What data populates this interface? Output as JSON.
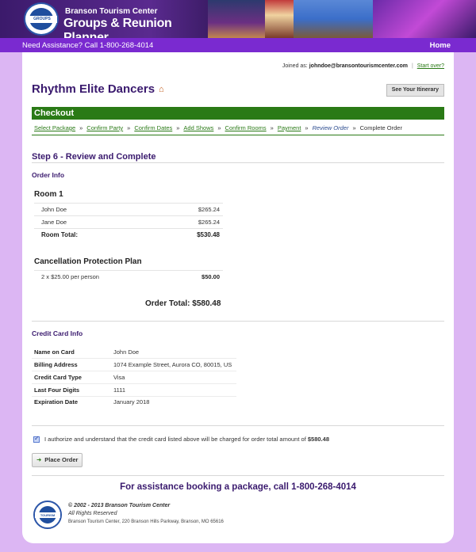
{
  "banner": {
    "brand_top": "Branson Tourism Center",
    "brand_main": "Groups & Reunion Planner",
    "seal_text": "GROUPS"
  },
  "navbar": {
    "assist": "Need Assistance? Call 1-800-268-4014",
    "home": "Home"
  },
  "joined": {
    "label": "Joined as:",
    "email": "johndoe@bransontourismcenter.com",
    "start_over": "Start over?"
  },
  "header": {
    "title": "Rhythm Elite Dancers",
    "itinerary_button": "See Your Itinerary"
  },
  "checkout": {
    "bar_title": "Checkout",
    "steps": [
      "Select Package",
      "Confirm Party",
      "Confirm Dates",
      "Add Shows",
      "Confirm Rooms",
      "Payment",
      "Review Order",
      "Complete Order"
    ],
    "separator": "»"
  },
  "step_heading": "Step 6 - Review and Complete",
  "order_info": {
    "heading": "Order Info",
    "room": {
      "title": "Room 1",
      "guests": [
        {
          "name": "John Doe",
          "price": "$265.24"
        },
        {
          "name": "Jane Doe",
          "price": "$265.24"
        }
      ],
      "total_label": "Room Total:",
      "total_value": "$530.48"
    },
    "cancellation": {
      "title": "Cancellation Protection Plan",
      "line": "2 x $25.00 per person",
      "value": "$50.00"
    },
    "order_total": "Order Total: $580.48"
  },
  "credit_card": {
    "heading": "Credit Card Info",
    "rows": [
      {
        "label": "Name on Card",
        "value": "John Doe"
      },
      {
        "label": "Billing Address",
        "value": "1074 Example Street, Aurora CO, 80015, US"
      },
      {
        "label": "Credit Card Type",
        "value": "Visa"
      },
      {
        "label": "Last Four Digits",
        "value": "1111"
      },
      {
        "label": "Expiration Date",
        "value": "January 2018"
      }
    ]
  },
  "authorize": {
    "text": "I authorize and understand that the credit card listed above will be charged for order total amount of",
    "amount": "$580.48",
    "checked": true
  },
  "place_order_label": "Place Order",
  "assist_big": "For assistance booking a package, call 1-800-268-4014",
  "footer": {
    "copyright": "© 2002 - 2013 Branson Tourism Center",
    "rights": "All Rights Reserved",
    "address": "Branson Tourism Center, 220 Branson Hills Parkway, Branson, MO 65616",
    "seal_text": "TOURISM"
  },
  "colors": {
    "accent_purple": "#3a1a6e",
    "nav_purple": "#7a2ad0",
    "checkout_green": "#2a7a16",
    "page_bg": "#dcb6f3"
  }
}
